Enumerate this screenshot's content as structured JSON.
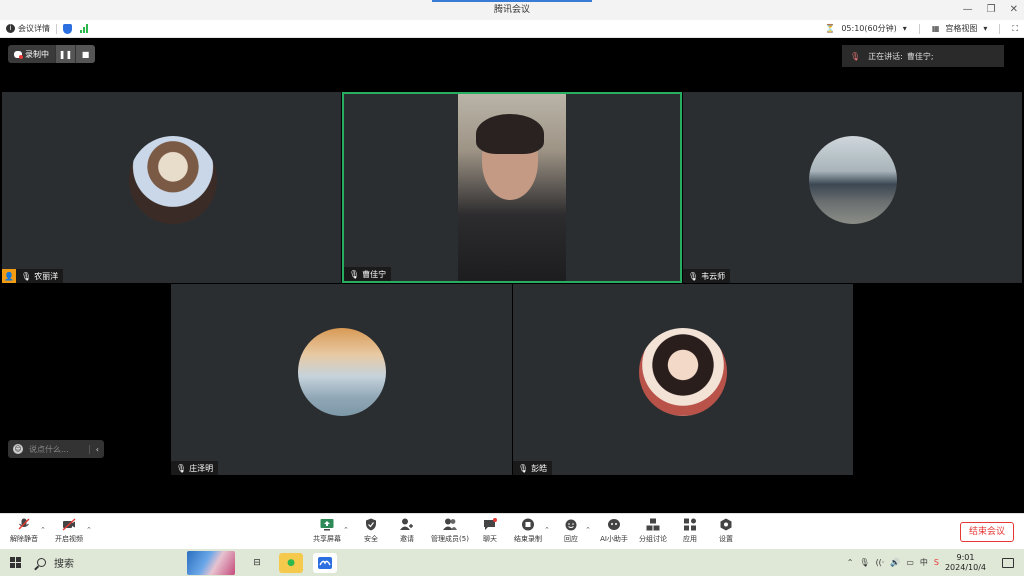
{
  "window": {
    "title": "腾讯会议",
    "minimize": "—",
    "restore": "❐",
    "close": "✕"
  },
  "infobar": {
    "meeting_details": "会议详情",
    "timer": "05:10(60分钟)",
    "view_mode": "宫格视图"
  },
  "stage": {
    "recording_label": "录制中",
    "pause_glyph": "❚❚",
    "stop_glyph": "■",
    "speaking_label": "正在讲话:",
    "speaking_name": "曹佳宁;",
    "chat_placeholder": "说点什么...",
    "chat_chevron": "‹"
  },
  "participants": [
    {
      "name": "农丽洋",
      "host": true
    },
    {
      "name": "曹佳宁",
      "active": true
    },
    {
      "name": "韦云师"
    },
    {
      "name": "庄泽明"
    },
    {
      "name": "彭皓"
    }
  ],
  "toolbar": {
    "unmute": "解除静音",
    "start_video": "开启视频",
    "share_screen": "共享屏幕",
    "security": "安全",
    "invite": "邀请",
    "manage_members": "管理成员(5)",
    "chat": "聊天",
    "end_recording": "结束录制",
    "react": "回应",
    "ai_assistant": "AI小助手",
    "breakout": "分组讨论",
    "apps": "应用",
    "settings": "设置",
    "end_meeting": "结束会议"
  },
  "taskbar": {
    "search_label": "搜索",
    "time": "9:01",
    "date": "2024/10/4"
  }
}
